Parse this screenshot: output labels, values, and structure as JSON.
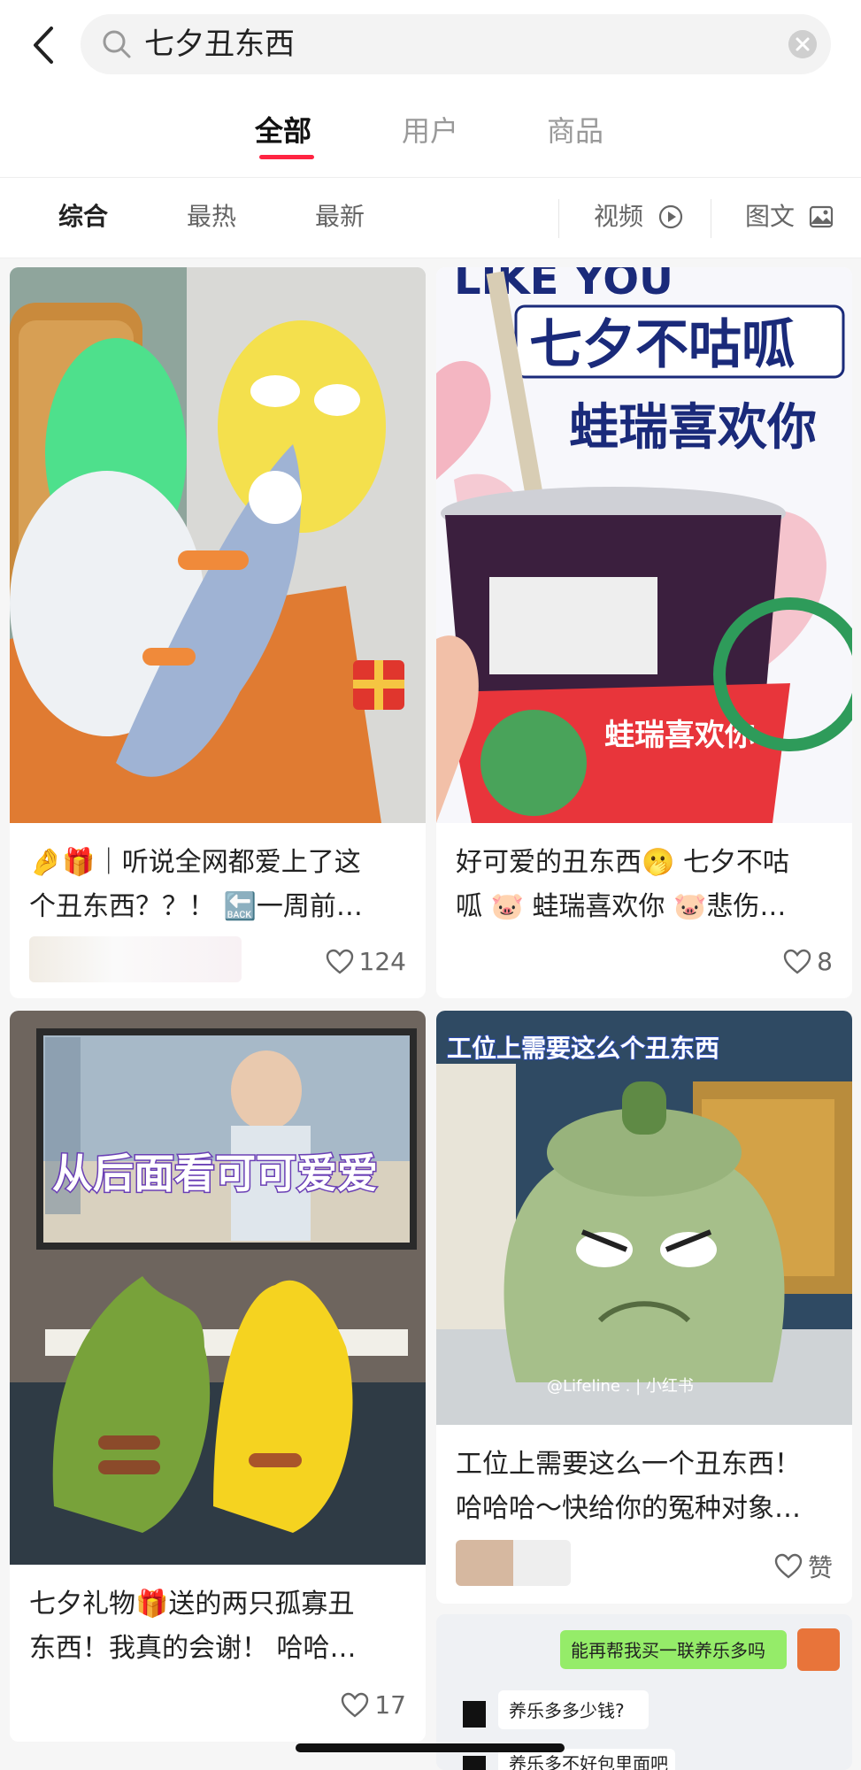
{
  "search": {
    "query": "七夕丑东西"
  },
  "tabs": [
    "全部",
    "用户",
    "商品"
  ],
  "filters": {
    "composite": "综合",
    "hottest": "最热",
    "newest": "最新",
    "video": "视频",
    "image_text": "图文"
  },
  "posts": [
    {
      "title_line1": "🤌🎁｜听说全网都爱上了这",
      "title_line2": "个丑东西？？！ 🔙一周前…",
      "likes": "124"
    },
    {
      "title_line1": "好可爱的丑东西🫢 七夕不咕",
      "title_line2": "呱 🐷 蛙瑞喜欢你 🐷悲伤…",
      "likes": "8",
      "image_text_1": "七夕不咕呱",
      "image_text_2": "蛙瑞喜欢你",
      "image_text_3": "LIKE YOU"
    },
    {
      "title_line1": "七夕礼物🎁送的两只孤寡丑",
      "title_line2": "东西！我真的会谢！ 哈哈…",
      "likes": "17",
      "image_caption": "从后面看可可爱爱"
    },
    {
      "title_line1": "工位上需要这么一个丑东西！",
      "title_line2": "哈哈哈～快给你的冤种对象…",
      "likes": "赞",
      "image_caption": "工位上需要这么个丑东西",
      "watermark": "@Lifeline . | 小红书"
    },
    {
      "chat_1": "能再帮我买一联养乐多吗",
      "chat_2": "养乐多多少钱?",
      "chat_3": "养乐多不好包里面吧"
    }
  ],
  "colors": {
    "accent": "#ff2442"
  }
}
